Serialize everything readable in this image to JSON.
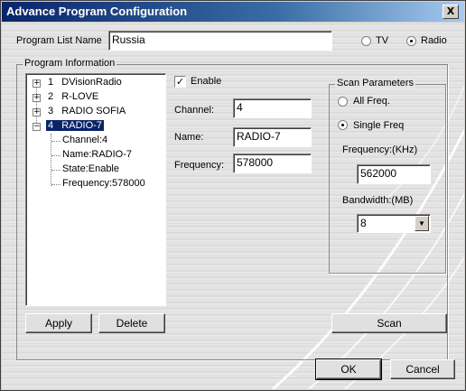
{
  "window": {
    "title": "Advance Program Configuration",
    "close_glyph": "X"
  },
  "program_list": {
    "label": "Program List Name",
    "value": "Russia",
    "tv_label": "TV",
    "radio_label": "Radio",
    "selected": "Radio"
  },
  "program_info": {
    "group_title": "Program Information",
    "tree": [
      {
        "num": "1",
        "name": "DVisionRadio",
        "expander": "+"
      },
      {
        "num": "2",
        "name": "R-LOVE",
        "expander": "+"
      },
      {
        "num": "3",
        "name": "RADIO SOFIA",
        "expander": "+"
      },
      {
        "num": "4",
        "name": "RADIO-7",
        "expander": "−",
        "selected": true,
        "children": [
          "Channel:4",
          "Name:RADIO-7",
          "State:Enable",
          "Frequency:578000"
        ]
      }
    ],
    "apply_label": "Apply",
    "delete_label": "Delete"
  },
  "details": {
    "enable_label": "Enable",
    "enable_checked": true,
    "channel_label": "Channel:",
    "channel_value": "4",
    "name_label": "Name:",
    "name_value": "RADIO-7",
    "frequency_label": "Frequency:",
    "frequency_value": "578000"
  },
  "scan": {
    "group_title": "Scan Parameters",
    "all_freq_label": "All Freq.",
    "single_freq_label": "Single Freq",
    "mode": "Single Freq",
    "frequency_label": "Frequency:(KHz)",
    "frequency_value": "562000",
    "bandwidth_label": "Bandwidth:(MB)",
    "bandwidth_value": "8",
    "scan_label": "Scan"
  },
  "footer": {
    "ok_label": "OK",
    "cancel_label": "Cancel"
  },
  "icons": {
    "close": "close-icon",
    "dropdown": "chevron-down-icon"
  }
}
